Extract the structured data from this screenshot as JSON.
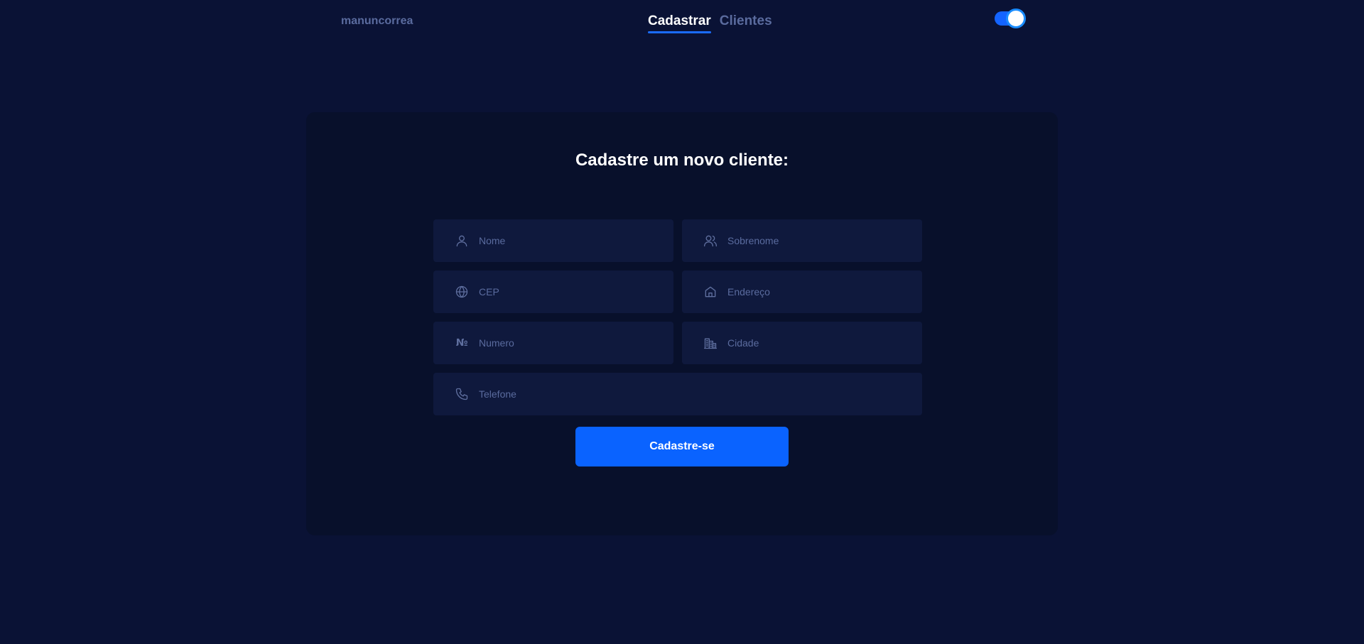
{
  "header": {
    "brand": "manuncorrea",
    "nav": [
      {
        "label": "Cadastrar",
        "active": true
      },
      {
        "label": "Clientes",
        "active": false
      }
    ],
    "theme_toggle": {
      "on": true
    }
  },
  "form": {
    "title": "Cadastre um novo cliente:",
    "fields": {
      "nome": {
        "placeholder": "Nome",
        "value": "",
        "icon": "user-icon"
      },
      "sobrenome": {
        "placeholder": "Sobrenome",
        "value": "",
        "icon": "users-icon"
      },
      "cep": {
        "placeholder": "CEP",
        "value": "",
        "icon": "globe-icon"
      },
      "endereco": {
        "placeholder": "Endereço",
        "value": "",
        "icon": "home-icon"
      },
      "numero": {
        "placeholder": "Numero",
        "value": "",
        "icon": "numero-sign-icon",
        "glyph": "№"
      },
      "cidade": {
        "placeholder": "Cidade",
        "value": "",
        "icon": "buildings-icon"
      },
      "telefone": {
        "placeholder": "Telefone",
        "value": "",
        "icon": "phone-icon"
      }
    },
    "submit_label": "Cadastre-se"
  },
  "colors": {
    "background": "#0a1235",
    "card": "#08102b",
    "field": "#0f193d",
    "accent": "#0a63ff",
    "muted_text": "#5a6b9e"
  }
}
